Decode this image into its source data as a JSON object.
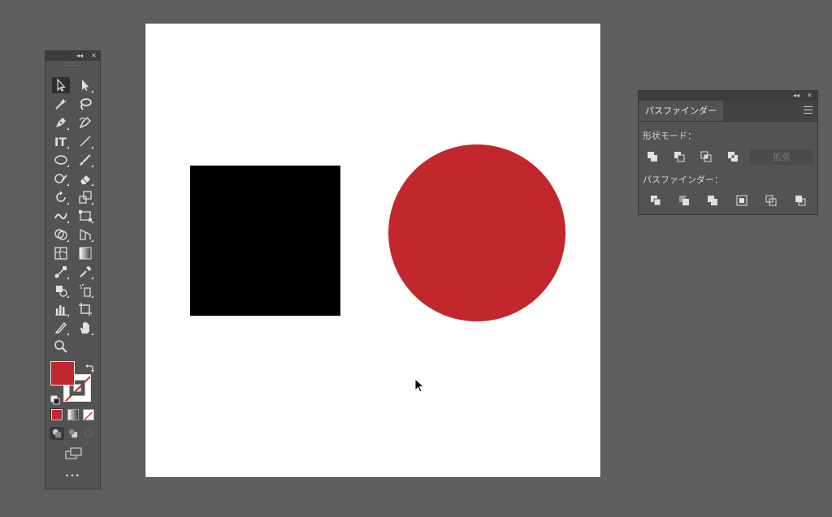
{
  "tools_panel": {
    "collapse_glyph": "◂◂",
    "close_glyph": "✕",
    "more_label": "•••",
    "fill_color": "#c1272d",
    "stroke_color": "none"
  },
  "artboard": {
    "rectangle_color": "#000000",
    "circle_color": "#c1272d"
  },
  "pathfinder": {
    "collapse_glyph": "◂◂",
    "close_glyph": "✕",
    "tab_label": "パスファインダー",
    "shape_modes_label": "形状モード：",
    "pathfinders_label": "パスファインダー：",
    "expand_label": "拡張",
    "shape_mode_icons": [
      "unite-icon",
      "minus-front-icon",
      "intersect-icon",
      "exclude-icon"
    ],
    "pathfinder_icons": [
      "divide-icon",
      "trim-icon",
      "merge-icon",
      "crop-icon",
      "outline-icon",
      "minus-back-icon"
    ]
  }
}
